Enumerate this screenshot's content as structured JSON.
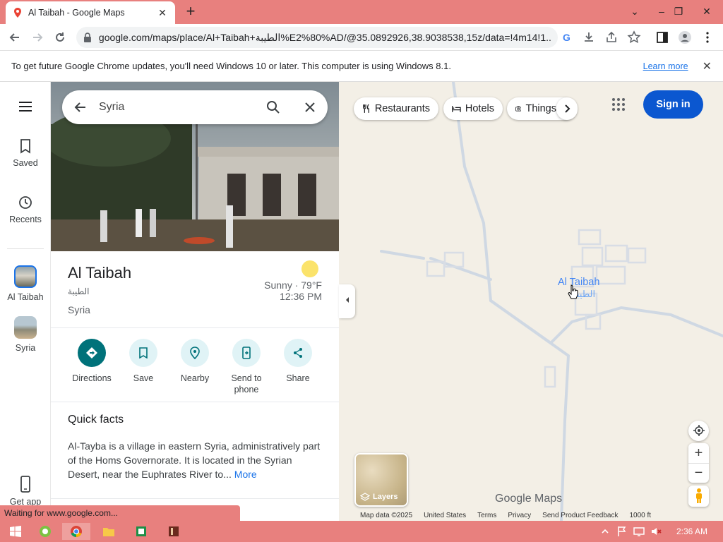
{
  "browser": {
    "tab_title": "Al Taibah - Google Maps",
    "tab_close": "✕",
    "new_tab": "+",
    "window_minimize": "–",
    "window_maximize": "❐",
    "window_close": "✕",
    "window_chevron": "⌄",
    "url": "google.com/maps/place/Al+Taibah+الطيبة%E2%80%AD/@35.0892926,38.9038538,15z/data=!4m14!1...",
    "infobar_message": "To get future Google Chrome updates, you'll need Windows 10 or later. This computer is using Windows 8.1.",
    "infobar_link": "Learn more",
    "infobar_close": "✕",
    "status_text": "Waiting for www.google.com..."
  },
  "rail": {
    "saved": "Saved",
    "recents": "Recents",
    "al_taibah": "Al Taibah",
    "syria": "Syria",
    "get_app": "Get app"
  },
  "search": {
    "query": "Syria"
  },
  "place": {
    "title": "Al Taibah",
    "title_arabic": "الطيبة",
    "country": "Syria",
    "weather_line1": "Sunny · 79°F",
    "weather_line2": "12:36 PM"
  },
  "actions": [
    {
      "label": "Directions"
    },
    {
      "label": "Save"
    },
    {
      "label": "Nearby"
    },
    {
      "label": "Send to phone"
    },
    {
      "label": "Share"
    }
  ],
  "quick_facts": {
    "title": "Quick facts",
    "text": "Al-Tayba is a village in eastern Syria, administratively part of the Homs Governorate. It is located in the Syrian Desert, near the Euphrates River to...",
    "more": "More"
  },
  "map": {
    "chips": [
      "Restaurants",
      "Hotels",
      "Things"
    ],
    "sign_in": "Sign in",
    "place_label": "Al Taibah",
    "place_label_arabic": "الطيبة",
    "layers": "Layers",
    "logo": "Google Maps",
    "footer": [
      "Map data ©2025",
      "United States",
      "Terms",
      "Privacy",
      "Send Product Feedback",
      "1000 ft"
    ],
    "zoom_in": "+",
    "zoom_out": "−"
  },
  "taskbar": {
    "time": "2:36 AM"
  },
  "colors": {
    "accent": "#0b57d0",
    "directions": "#00727a",
    "chrome_frame": "#e8807e",
    "map_bg": "#f3efe6"
  }
}
